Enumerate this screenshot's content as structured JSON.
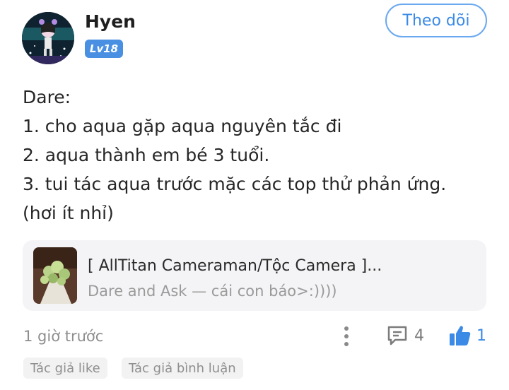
{
  "author": {
    "name": "Hyen",
    "level": "Lv18"
  },
  "follow_label": "Theo dõi",
  "post": {
    "lines": [
      "Dare:",
      "1. cho aqua gặp aqua nguyên tắc đi",
      "2. aqua thành em bé 3 tuổi.",
      "3. tui tác aqua trước mặc các top thử phản ứng.",
      "(hơi ít nhỉ)"
    ]
  },
  "reference": {
    "title": "[ AllTitan Cameraman/Tộc Camera ]...",
    "subtitle": "Dare and Ask — cái con báo>:))))"
  },
  "meta": {
    "timestamp": "1 giờ trước",
    "comment_count": "4",
    "like_count": "1"
  },
  "tags": [
    "Tác giả like",
    "Tác giả bình luận"
  ],
  "colors": {
    "accent": "#3b8ae6",
    "badge": "#4a90e2",
    "card_bg": "#f4f4f6",
    "muted": "#8e8e8e"
  },
  "icons": {
    "avatar": "avatar-image",
    "more": "more-vertical-icon",
    "comment": "comment-icon",
    "like": "thumbs-up-icon"
  }
}
